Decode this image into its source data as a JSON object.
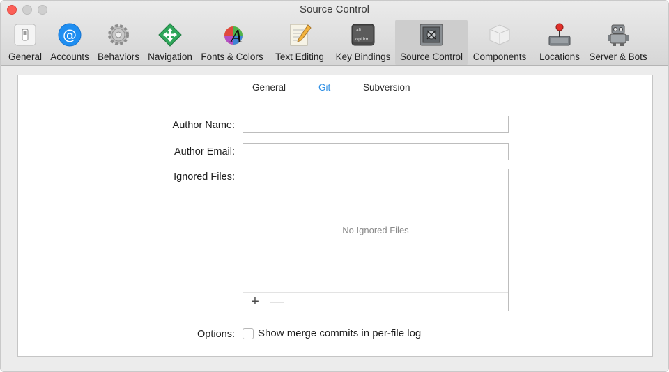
{
  "window": {
    "title": "Source Control"
  },
  "toolbar": {
    "items": [
      {
        "label": "General",
        "icon": "general-switch-icon"
      },
      {
        "label": "Accounts",
        "icon": "at-sign-icon"
      },
      {
        "label": "Behaviors",
        "icon": "gears-icon"
      },
      {
        "label": "Navigation",
        "icon": "navigation-arrows-icon"
      },
      {
        "label": "Fonts & Colors",
        "icon": "font-color-wheel-icon"
      },
      {
        "label": "Text Editing",
        "icon": "notepad-pencil-icon"
      },
      {
        "label": "Key Bindings",
        "icon": "option-key-icon"
      },
      {
        "label": "Source Control",
        "icon": "safe-icon"
      },
      {
        "label": "Components",
        "icon": "components-box-icon"
      },
      {
        "label": "Locations",
        "icon": "joystick-drive-icon"
      },
      {
        "label": "Server & Bots",
        "icon": "robot-icon"
      }
    ],
    "active": "Source Control"
  },
  "tabs": [
    "General",
    "Git",
    "Subversion"
  ],
  "selected_tab": "Git",
  "form": {
    "author_name_label": "Author Name:",
    "author_name_value": "",
    "author_email_label": "Author Email:",
    "author_email_value": "",
    "ignored_files_label": "Ignored Files:",
    "ignored_files_empty": "No Ignored Files",
    "add_symbol": "+",
    "remove_symbol": "—",
    "options_label": "Options:",
    "merge_commits_checkbox": "Show merge commits in per-file log",
    "merge_commits_checked": false
  },
  "colors": {
    "accent": "#2d8ee4",
    "close": "#fc5f57"
  }
}
